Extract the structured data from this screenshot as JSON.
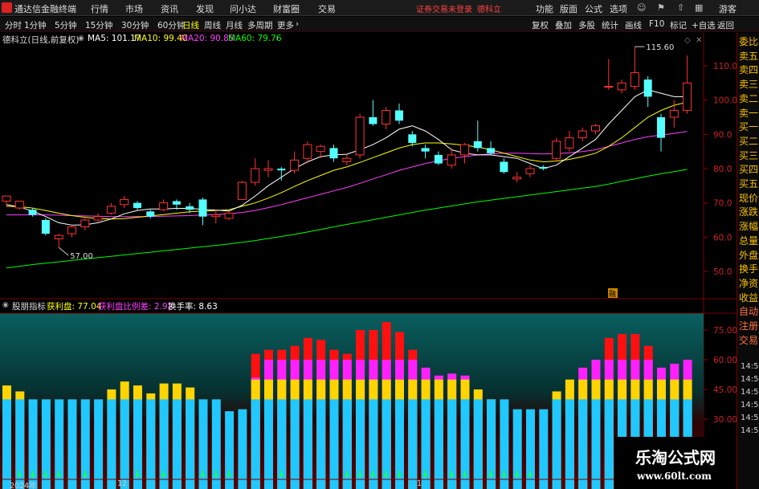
{
  "app": {
    "title": "通达信金融终端",
    "menu": [
      "行情",
      "市场",
      "资讯",
      "发现",
      "问小达",
      "财富圈",
      "交易"
    ],
    "warning_text": "证券交易未登录",
    "stock_tag": "德科立",
    "right_menu": [
      "功能",
      "版面",
      "公式",
      "选项"
    ],
    "guest": "游客"
  },
  "toolbar": {
    "periods": [
      "分时",
      "1分钟",
      "5分钟",
      "15分钟",
      "30分钟",
      "60分钟",
      "日线",
      "周线",
      "月线",
      "多周期",
      "更多"
    ],
    "active_period": "日线",
    "right_buttons": [
      "复权",
      "叠加",
      "多股",
      "统计",
      "画线",
      "F10",
      "标记",
      "+自选",
      "返回"
    ]
  },
  "chart_header": {
    "name": "德科立(日线,前复权)",
    "ma5": "MA5: 101.17",
    "ma10": "MA10: 99.40",
    "ma20": "MA20: 90.85",
    "ma60": "MA60: 79.76",
    "colors": {
      "ma5": "#ffffff",
      "ma10": "#ffff00",
      "ma20": "#ff40ff",
      "ma60": "#00ff00"
    }
  },
  "price_axis": [
    "110.0",
    "100.0",
    "90.0",
    "80.0",
    "70.0",
    "60.0",
    "50.0"
  ],
  "annotations": {
    "high": "115.60",
    "low": "57.00",
    "badge": "融"
  },
  "right_panel": {
    "items": [
      "委比",
      "卖五",
      "卖四",
      "卖三",
      "卖二",
      "卖一",
      "买一",
      "买二",
      "买三",
      "买四",
      "买五",
      "现价",
      "涨跌",
      "涨幅",
      "总量",
      "外盘",
      "换手",
      "净资",
      "收益",
      "自动",
      "注册",
      "交易"
    ],
    "times": [
      "14:56",
      "14:56",
      "14:56",
      "14:56",
      "14:56",
      "14:56"
    ]
  },
  "indicator": {
    "name": "股朋指标",
    "profit": "获利盘: 77.04",
    "profit_ratio": "获利盘比例差: 2.92",
    "turnover": "换手率: 8.63",
    "axis": [
      "75.00",
      "60.00",
      "45.00",
      "30.00"
    ]
  },
  "dates": [
    "2024年",
    "12",
    "1"
  ],
  "watermark": {
    "title": "乐淘公式网",
    "url": "www.60lt.com"
  },
  "chart_data": {
    "type": "candlestick",
    "ylim": [
      45,
      118
    ],
    "candles": [
      [
        70.5,
        72,
        71,
        69
      ],
      [
        68.5,
        70.5,
        69.5,
        68
      ],
      [
        68,
        66.5,
        68.5,
        66
      ],
      [
        65,
        61,
        65.5,
        60.5
      ],
      [
        59.5,
        60.5,
        61,
        57
      ],
      [
        61,
        63,
        63.5,
        60
      ],
      [
        63,
        65,
        65.5,
        62
      ],
      [
        65,
        66,
        67,
        64.5
      ],
      [
        67,
        69,
        70,
        66.5
      ],
      [
        69.5,
        71,
        72,
        68.5
      ],
      [
        70,
        68.5,
        70.5,
        68
      ],
      [
        67.5,
        66,
        68,
        65.5
      ],
      [
        68,
        70,
        71,
        67.5
      ],
      [
        70.5,
        69.5,
        71,
        68
      ],
      [
        69,
        68,
        70,
        67
      ],
      [
        71,
        66,
        71.5,
        63.5
      ],
      [
        66,
        66.5,
        68,
        64
      ],
      [
        65.5,
        67,
        67.5,
        65
      ],
      [
        71,
        76,
        76.5,
        71
      ],
      [
        76,
        80,
        83,
        75
      ],
      [
        79.5,
        80,
        82.5,
        77.5
      ],
      [
        80,
        79.5,
        80.5,
        76.5
      ],
      [
        79.5,
        82.5,
        85,
        78.5
      ],
      [
        83,
        87,
        88,
        81.5
      ],
      [
        85,
        86.5,
        87,
        83
      ],
      [
        86,
        83,
        87,
        82
      ],
      [
        82,
        83,
        84,
        81
      ],
      [
        84,
        95,
        96,
        83
      ],
      [
        95,
        93,
        100,
        92.5
      ],
      [
        93,
        97,
        98,
        91.5
      ],
      [
        97,
        94,
        99,
        93
      ],
      [
        90,
        87.5,
        91,
        86.5
      ],
      [
        86,
        85,
        87,
        83
      ],
      [
        84,
        81.5,
        85,
        81
      ],
      [
        81,
        84,
        86,
        80
      ],
      [
        84,
        87,
        87.5,
        81.5
      ],
      [
        88,
        86,
        94,
        85
      ],
      [
        86,
        84.5,
        88,
        84
      ],
      [
        82,
        79,
        83,
        78.5
      ],
      [
        77,
        77.5,
        79,
        76
      ],
      [
        78.5,
        80,
        81,
        77.5
      ],
      [
        80.5,
        80,
        81,
        79.5
      ],
      [
        83,
        88,
        89,
        82
      ],
      [
        86,
        89,
        91,
        85
      ],
      [
        89,
        91,
        92,
        88
      ],
      [
        91,
        92.5,
        93,
        90
      ],
      [
        104,
        104,
        112,
        103
      ],
      [
        103,
        105,
        106,
        102
      ],
      [
        104,
        108,
        115.6,
        103
      ],
      [
        106,
        101,
        107,
        98
      ],
      [
        95,
        89,
        96,
        85
      ],
      [
        95,
        97,
        100,
        92
      ],
      [
        97,
        105,
        113,
        96
      ]
    ],
    "ma5": [
      69.5,
      68.8,
      67.6,
      66,
      64.2,
      63.5,
      63.6,
      64.2,
      65.3,
      66.8,
      67.8,
      68.2,
      68.2,
      68.4,
      68.4,
      68.1,
      67.9,
      67.6,
      69.3,
      72,
      75,
      77.5,
      80,
      82,
      83.5,
      84,
      84.2,
      85.5,
      87,
      89,
      91.5,
      92.5,
      91,
      88.5,
      85.5,
      84.5,
      84,
      84,
      83.5,
      83,
      81.5,
      80,
      81,
      83.5,
      86,
      88.5,
      93,
      97,
      101,
      103,
      102,
      101,
      101
    ],
    "ma10": [
      69,
      68.9,
      68.5,
      67.8,
      67,
      66.3,
      65.8,
      65.4,
      65.3,
      65.4,
      65.8,
      66.2,
      66.6,
      67,
      67.4,
      67.6,
      67.8,
      68,
      69,
      70,
      71.4,
      73,
      74.8,
      76.5,
      78,
      79.5,
      80.5,
      81.8,
      83.2,
      84.6,
      86,
      87,
      87.5,
      87.5,
      87.2,
      86.8,
      86.3,
      85.5,
      84.5,
      83.5,
      82.5,
      82,
      82.2,
      82.7,
      83.5,
      84.5,
      86.5,
      89,
      92,
      95,
      97,
      98.5,
      99.4
    ],
    "ma20": [
      66.5,
      66.5,
      66.5,
      66.5,
      66.4,
      66.3,
      66.2,
      66.1,
      66,
      66,
      66,
      66,
      66.1,
      66.2,
      66.3,
      66.5,
      66.6,
      66.8,
      67.2,
      67.8,
      68.6,
      69.5,
      70.5,
      71.5,
      72.5,
      73.5,
      74.5,
      75.7,
      77,
      78.2,
      79.5,
      80.5,
      81.5,
      82.3,
      83,
      83.5,
      84,
      84.3,
      84.5,
      84.5,
      84.4,
      84.3,
      84.4,
      84.6,
      85,
      85.5,
      86.5,
      87.5,
      88.5,
      89.3,
      89.8,
      90.3,
      90.85
    ],
    "ma60": [
      51,
      51.5,
      52,
      52.4,
      52.8,
      53.2,
      53.6,
      54,
      54.4,
      54.8,
      55.2,
      55.6,
      56,
      56.4,
      56.8,
      57.2,
      57.6,
      58,
      58.5,
      59,
      59.6,
      60.2,
      60.8,
      61.5,
      62.2,
      63,
      63.7,
      64.4,
      65.1,
      65.8,
      66.5,
      67.2,
      67.9,
      68.5,
      69.1,
      69.7,
      70.3,
      70.8,
      71.3,
      71.8,
      72.3,
      72.8,
      73.3,
      73.8,
      74.3,
      74.8,
      75.5,
      76.3,
      77,
      77.8,
      78.5,
      79.1,
      79.76
    ],
    "indicator_bars": {
      "ylim": [
        22,
        85
      ],
      "blue": [
        40,
        40,
        40,
        40,
        40,
        40,
        40,
        40,
        40,
        40,
        40,
        40,
        40,
        40,
        40,
        40,
        40,
        34,
        35,
        40,
        40,
        40,
        40,
        40,
        40,
        40,
        40,
        40,
        40,
        40,
        40,
        40,
        40,
        40,
        40,
        40,
        40,
        40,
        40,
        35,
        35,
        35,
        40,
        40,
        40,
        40,
        40,
        40,
        40,
        40,
        40,
        40,
        40
      ],
      "yellow": [
        47,
        44,
        0,
        0,
        0,
        0,
        0,
        0,
        45,
        49,
        47,
        43,
        48,
        48,
        46,
        0,
        0,
        0,
        0,
        50,
        50,
        50,
        50,
        50,
        50,
        50,
        50,
        50,
        50,
        50,
        50,
        50,
        50,
        50,
        50,
        50,
        45,
        40,
        0,
        0,
        0,
        0,
        44,
        50,
        50,
        50,
        50,
        50,
        50,
        50,
        50,
        50,
        50
      ],
      "magenta": [
        0,
        0,
        0,
        0,
        0,
        0,
        0,
        0,
        0,
        0,
        0,
        0,
        0,
        0,
        0,
        0,
        0,
        0,
        0,
        51,
        60,
        60,
        60,
        60,
        60,
        60,
        60,
        60,
        60,
        60,
        60,
        60,
        56,
        52,
        53,
        52,
        0,
        0,
        0,
        0,
        0,
        0,
        0,
        0,
        56,
        60,
        60,
        60,
        60,
        60,
        56,
        58,
        60
      ],
      "red": [
        0,
        0,
        0,
        0,
        0,
        0,
        0,
        0,
        0,
        0,
        0,
        0,
        0,
        0,
        0,
        0,
        0,
        0,
        0,
        63,
        65,
        65,
        67,
        71,
        70,
        65,
        63,
        75,
        75,
        79,
        74,
        65,
        0,
        0,
        0,
        0,
        0,
        0,
        0,
        0,
        0,
        0,
        0,
        0,
        0,
        0,
        71,
        73,
        73,
        67,
        0,
        0,
        0
      ],
      "arrows": [
        1,
        2,
        3,
        4,
        6,
        10,
        12,
        15,
        16,
        17,
        21,
        26,
        27,
        28,
        29,
        30,
        32,
        34,
        35,
        37,
        38,
        39,
        40
      ]
    }
  }
}
